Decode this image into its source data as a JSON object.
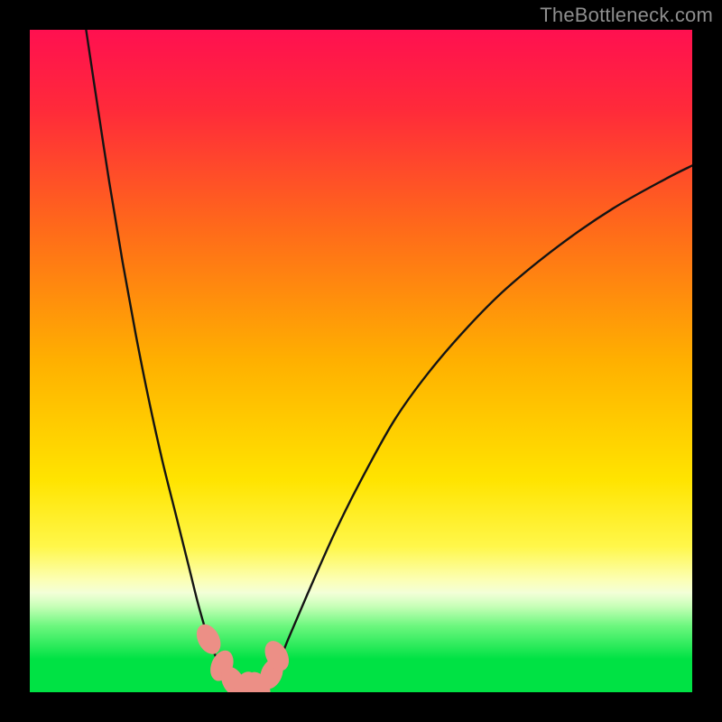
{
  "watermark": "TheBottleneck.com",
  "colors": {
    "bg_black": "#000000",
    "watermark_grey": "#8e8e8e",
    "curve_stroke": "#141414",
    "marker_fill": "#ec8f86",
    "green_band": "#00e244"
  },
  "chart_data": {
    "type": "line",
    "title": "",
    "xlabel": "",
    "ylabel": "",
    "xlim": [
      0,
      100
    ],
    "ylim": [
      0,
      100
    ],
    "gradient_stops": [
      {
        "offset": 0,
        "color": "#ff1050"
      },
      {
        "offset": 12,
        "color": "#ff2a3a"
      },
      {
        "offset": 30,
        "color": "#ff6a1a"
      },
      {
        "offset": 50,
        "color": "#ffb000"
      },
      {
        "offset": 68,
        "color": "#ffe400"
      },
      {
        "offset": 78,
        "color": "#fff74a"
      },
      {
        "offset": 83,
        "color": "#fcffb4"
      },
      {
        "offset": 85,
        "color": "#f3ffd8"
      },
      {
        "offset": 87,
        "color": "#c8ffb8"
      },
      {
        "offset": 90,
        "color": "#6cf77e"
      },
      {
        "offset": 95,
        "color": "#00e244"
      },
      {
        "offset": 100,
        "color": "#00e244"
      }
    ],
    "series": [
      {
        "name": "left-branch",
        "x": [
          8.5,
          10,
          12,
          14,
          16,
          18,
          20,
          22,
          24,
          25.5,
          27,
          28.5,
          30,
          31.5
        ],
        "y": [
          100,
          90,
          77,
          65,
          54,
          44,
          35,
          27,
          19,
          13,
          8,
          4.5,
          2,
          0.7
        ]
      },
      {
        "name": "right-branch",
        "x": [
          35.5,
          37,
          39,
          42,
          46,
          50,
          55,
          60,
          66,
          72,
          80,
          88,
          96,
          100
        ],
        "y": [
          0.7,
          3,
          8,
          15,
          24,
          32,
          41,
          48,
          55,
          61,
          67.5,
          73,
          77.5,
          79.5
        ]
      }
    ],
    "markers": [
      {
        "x": 27.0,
        "y": 8.0
      },
      {
        "x": 29.0,
        "y": 4.0
      },
      {
        "x": 30.7,
        "y": 1.6
      },
      {
        "x": 32.5,
        "y": 0.8
      },
      {
        "x": 34.5,
        "y": 0.8
      },
      {
        "x": 36.5,
        "y": 2.8
      },
      {
        "x": 37.3,
        "y": 5.5
      }
    ],
    "marker_radius_x": 1.6,
    "marker_radius_y": 2.4
  }
}
